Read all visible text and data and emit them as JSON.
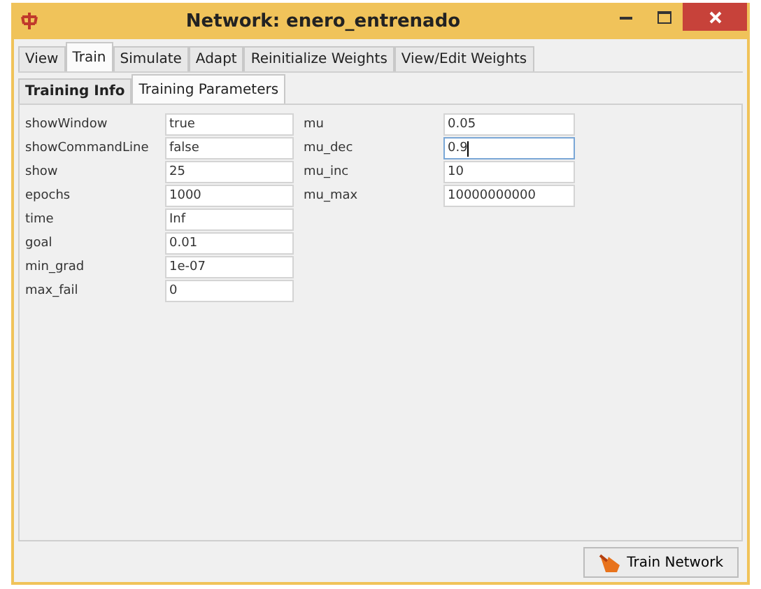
{
  "window": {
    "title": "Network: enero_entrenado"
  },
  "tabs": [
    {
      "label": "View",
      "selected": false
    },
    {
      "label": "Train",
      "selected": true
    },
    {
      "label": "Simulate",
      "selected": false
    },
    {
      "label": "Adapt",
      "selected": false
    },
    {
      "label": "Reinitialize Weights",
      "selected": false
    },
    {
      "label": "View/Edit Weights",
      "selected": false
    }
  ],
  "subtabs": [
    {
      "label": "Training Info",
      "selected": false
    },
    {
      "label": "Training Parameters",
      "selected": true
    }
  ],
  "parameters": [
    [
      {
        "label": "showWindow",
        "value": "true",
        "focused": false
      },
      {
        "label": "showCommandLine",
        "value": "false",
        "focused": false
      },
      {
        "label": "show",
        "value": "25",
        "focused": false
      },
      {
        "label": "epochs",
        "value": "1000",
        "focused": false
      },
      {
        "label": "time",
        "value": "Inf",
        "focused": false
      },
      {
        "label": "goal",
        "value": "0.01",
        "focused": false
      },
      {
        "label": "min_grad",
        "value": "1e-07",
        "focused": false
      },
      {
        "label": "max_fail",
        "value": "0",
        "focused": false
      }
    ],
    [
      {
        "label": "mu",
        "value": "0.05",
        "focused": false
      },
      {
        "label": "mu_dec",
        "value": "0.9",
        "focused": true
      },
      {
        "label": "mu_inc",
        "value": "10",
        "focused": false
      },
      {
        "label": "mu_max",
        "value": "10000000000",
        "focused": false
      }
    ]
  ],
  "train_button": {
    "label": "Train Network"
  }
}
